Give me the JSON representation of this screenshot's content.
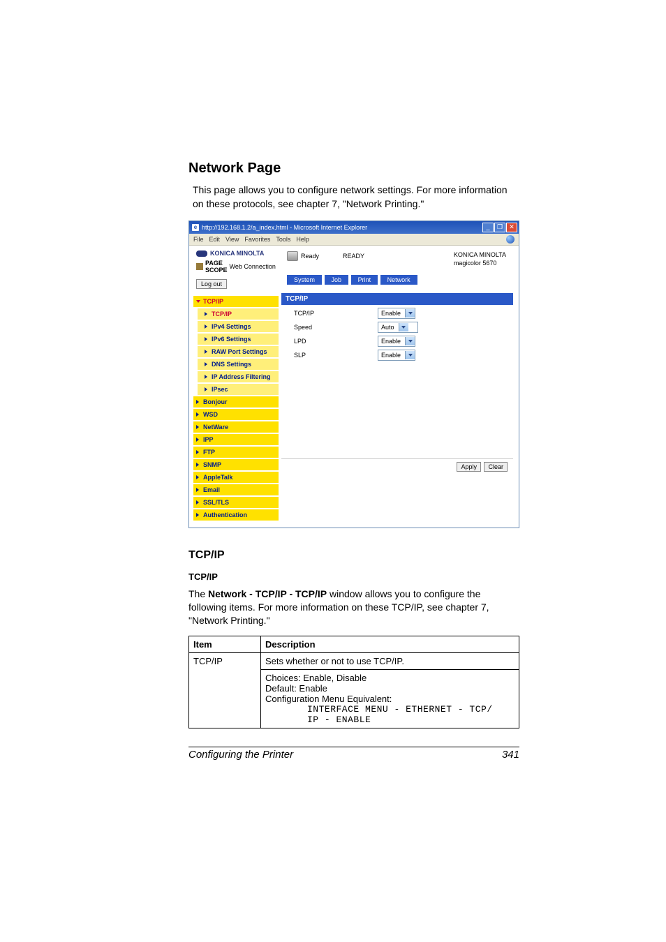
{
  "doc": {
    "heading": "Network Page",
    "intro": "This page allows you to configure network settings. For more information on these protocols, see chapter 7, \"Network Printing.\"",
    "tcpip_heading": "TCP/IP",
    "tcpip_subheading": "TCP/IP",
    "tcpip_body_prefix": "The ",
    "tcpip_body_bold": "Network - TCP/IP - TCP/IP",
    "tcpip_body_suffix": " window allows you to configure the following items. For more information on these TCP/IP, see chapter 7, \"Network Printing.\"",
    "table": {
      "col1": "Item",
      "col2": "Description",
      "row_item": "TCP/IP",
      "row_desc_line1": "Sets whether or not to use TCP/IP.",
      "row_choices": "Choices: Enable, Disable",
      "row_default": "Default:  Enable",
      "row_config": "Configuration Menu Equivalent:",
      "row_menu1": "INTERFACE MENU - ETHERNET - TCP/",
      "row_menu2": "IP - ENABLE"
    },
    "footer_left": "Configuring the Printer",
    "footer_page": "341"
  },
  "window": {
    "title": "http://192.168.1.2/a_index.html - Microsoft Internet Explorer",
    "buttons": {
      "min": "_",
      "max": "❐",
      "close": "✕"
    },
    "menus": [
      "File",
      "Edit",
      "View",
      "Favorites",
      "Tools",
      "Help"
    ],
    "header": {
      "brand": "KONICA MINOLTA",
      "pagescope": "Web Connection",
      "ready_label": "Ready",
      "ready_status": "READY",
      "device_line1": "KONICA MINOLTA",
      "device_line2": "magicolor 5670",
      "logout": "Log out"
    },
    "tabs": [
      "System",
      "Job",
      "Print",
      "Network"
    ],
    "sidebar": {
      "items": [
        {
          "label": "TCP/IP",
          "selected": true,
          "down": true
        },
        {
          "label": "Bonjour"
        },
        {
          "label": "WSD"
        },
        {
          "label": "NetWare"
        },
        {
          "label": "IPP"
        },
        {
          "label": "FTP"
        },
        {
          "label": "SNMP"
        },
        {
          "label": "AppleTalk"
        },
        {
          "label": "Email"
        },
        {
          "label": "SSL/TLS"
        },
        {
          "label": "Authentication"
        }
      ],
      "subitems": [
        {
          "label": "TCP/IP",
          "selected": true
        },
        {
          "label": "IPv4 Settings"
        },
        {
          "label": "IPv6 Settings"
        },
        {
          "label": "RAW Port Settings"
        },
        {
          "label": "DNS Settings"
        },
        {
          "label": "IP Address Filtering"
        },
        {
          "label": "IPsec"
        }
      ]
    },
    "pane": {
      "title": "TCP/IP",
      "rows": [
        {
          "label": "TCP/IP",
          "value": "Enable",
          "wide": false
        },
        {
          "label": "Speed",
          "value": "Auto",
          "wide": true
        },
        {
          "label": "LPD",
          "value": "Enable",
          "wide": false
        },
        {
          "label": "SLP",
          "value": "Enable",
          "wide": false
        }
      ],
      "apply": "Apply",
      "clear": "Clear"
    }
  }
}
